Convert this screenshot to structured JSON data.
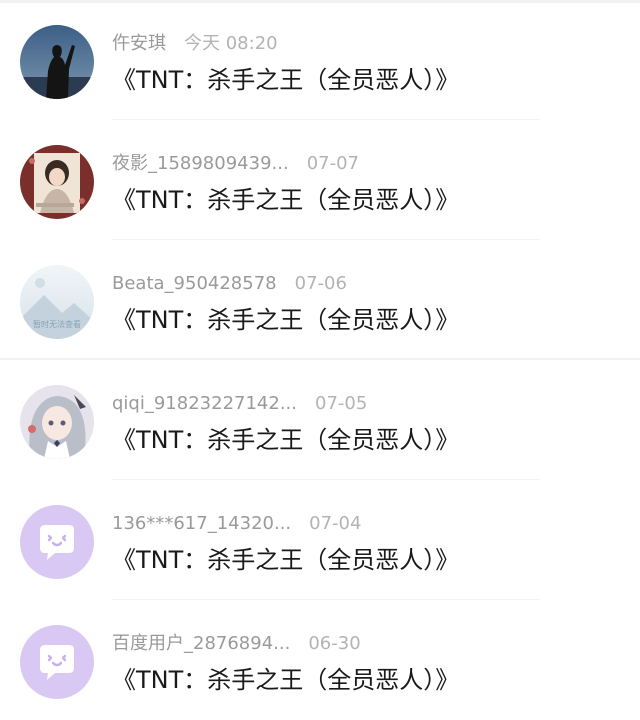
{
  "messages": [
    {
      "name": "仵安琪",
      "time": "今天 08:20",
      "text": "《TNT：杀手之王（全员恶人）》",
      "avatar_icon": "photo-silhouette"
    },
    {
      "name": "夜影_1589809439...",
      "time": "07-07",
      "text": "《TNT：杀手之王（全员恶人）》",
      "avatar_icon": "photo-illustration"
    },
    {
      "name": "Beata_950428578",
      "time": "07-06",
      "text": "《TNT：杀手之王（全员恶人）》",
      "avatar_icon": "placeholder-image",
      "avatar_caption": "暂时无法查看"
    },
    {
      "name": "qiqi_91823227142...",
      "time": "07-05",
      "text": "《TNT：杀手之王（全员恶人）》",
      "avatar_icon": "photo-anime"
    },
    {
      "name": "136***617_14320...",
      "time": "07-04",
      "text": "《TNT：杀手之王（全员恶人）》",
      "avatar_icon": "chat-bubble"
    },
    {
      "name": "百度用户_2876894...",
      "time": "06-30",
      "text": "《TNT：杀手之王（全员恶人）》",
      "avatar_icon": "chat-bubble"
    }
  ],
  "colors": {
    "name_text": "#9a9a9a",
    "time_text": "#b3b3b3",
    "message_text": "#1a1a1a",
    "default_avatar_bg": "#d9c8f3"
  }
}
